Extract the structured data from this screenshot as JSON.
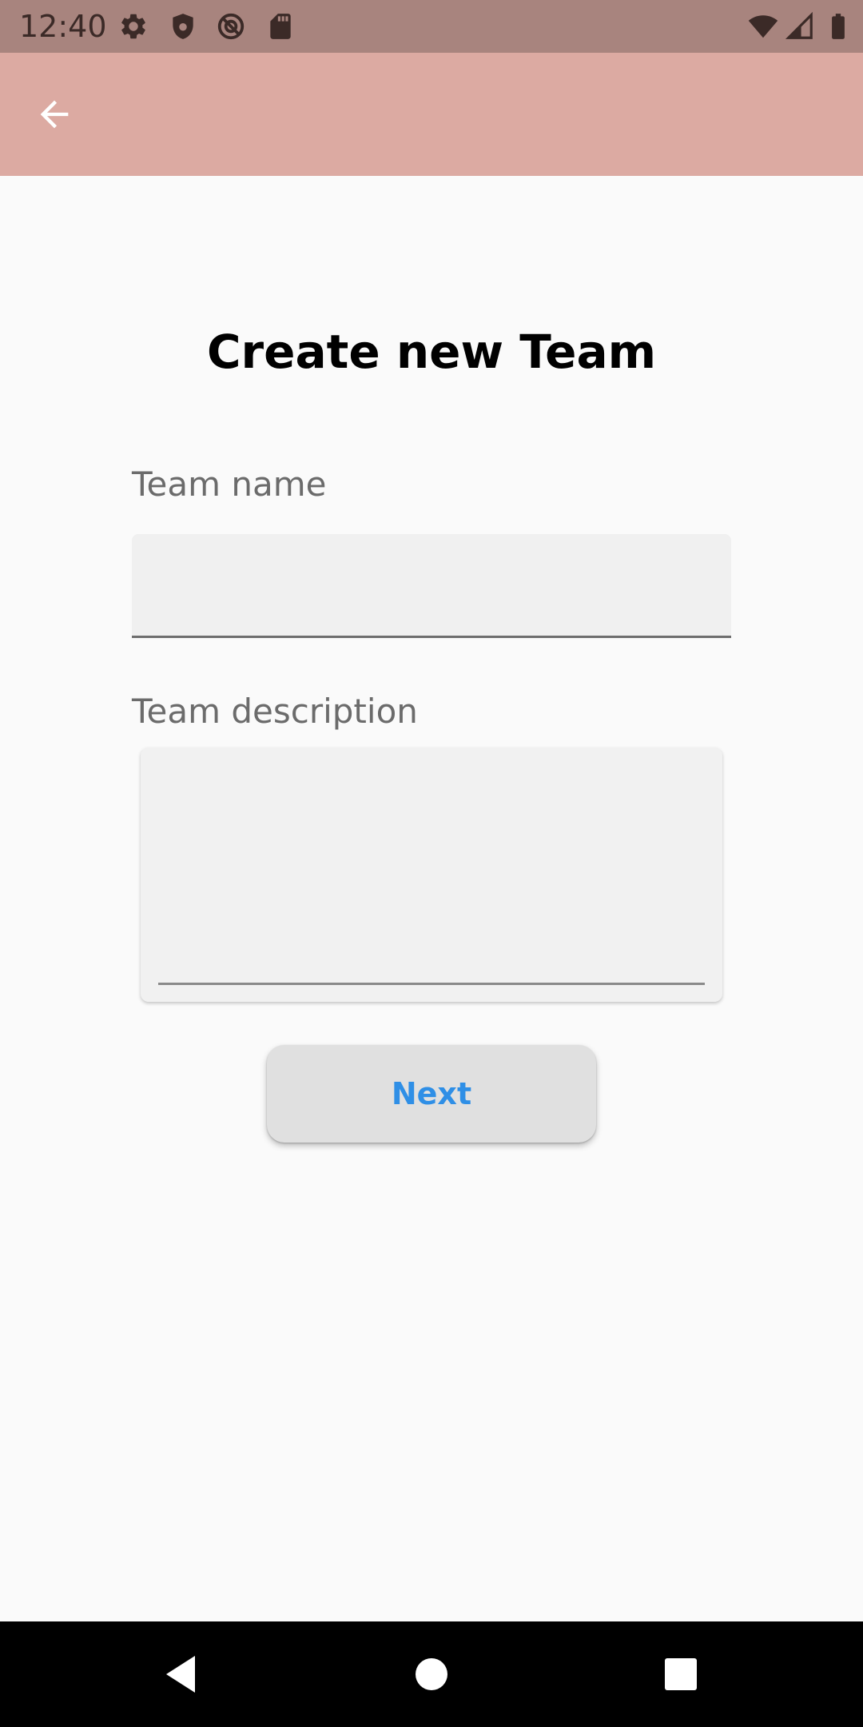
{
  "status_bar": {
    "time": "12:40",
    "icons": [
      "settings-icon",
      "shield-icon",
      "vpn-key-icon",
      "sd-card-icon",
      "wifi-icon",
      "signal-icon",
      "battery-icon"
    ]
  },
  "app_bar": {
    "back_icon": "arrow-back-icon",
    "background_color": "#dcaaa2"
  },
  "form": {
    "title": "Create new Team",
    "team_name_label": "Team name",
    "team_name_value": "",
    "team_description_label": "Team description",
    "team_description_value": "",
    "next_button_label": "Next",
    "next_button_color": "#2f8fe6"
  },
  "nav_bar": {
    "buttons": [
      "back-triangle-icon",
      "home-circle-icon",
      "recents-square-icon"
    ]
  }
}
